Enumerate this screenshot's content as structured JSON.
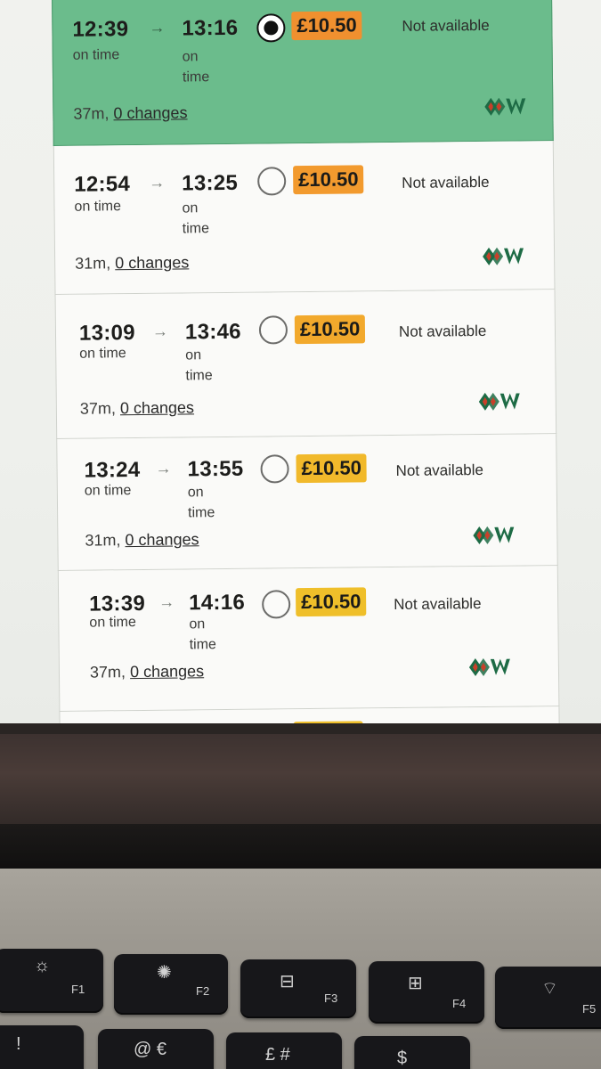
{
  "journeys": [
    {
      "dep": "12:39",
      "arr": "13:16",
      "dep_status": "on time",
      "arr_status": "on\ntime",
      "price": "£10.50",
      "availability": "Not available",
      "duration": "37m,",
      "changes": "0 changes",
      "selected": true,
      "price_color": "#f0902f"
    },
    {
      "dep": "12:54",
      "arr": "13:25",
      "dep_status": "on time",
      "arr_status": "on\ntime",
      "price": "£10.50",
      "availability": "Not available",
      "duration": "31m,",
      "changes": "0 changes",
      "selected": false,
      "price_color": "#f29a2e"
    },
    {
      "dep": "13:09",
      "arr": "13:46",
      "dep_status": "on time",
      "arr_status": "on\ntime",
      "price": "£10.50",
      "availability": "Not available",
      "duration": "37m,",
      "changes": "0 changes",
      "selected": false,
      "price_color": "#f2a92c"
    },
    {
      "dep": "13:24",
      "arr": "13:55",
      "dep_status": "on time",
      "arr_status": "on\ntime",
      "price": "£10.50",
      "availability": "Not available",
      "duration": "31m,",
      "changes": "0 changes",
      "selected": false,
      "price_color": "#f1b92b"
    },
    {
      "dep": "13:39",
      "arr": "14:16",
      "dep_status": "on time",
      "arr_status": "on\ntime",
      "price": "£10.50",
      "availability": "Not available",
      "duration": "37m,",
      "changes": "0 changes",
      "selected": false,
      "price_color": "#efbf2a"
    }
  ],
  "arrow": "→",
  "operator_logo": "gwr-logo",
  "keyboard": {
    "f1": "F1",
    "f2": "F2",
    "f3": "F3",
    "f4": "F4",
    "f5": "F5",
    "f1_icon": "brightness-down-icon",
    "f2_icon": "brightness-up-icon",
    "f3_icon": "mission-control-icon",
    "f4_icon": "launchpad-icon",
    "f5_icon": "keyboard-backlight-icon",
    "key_1": "!",
    "key_2": "@ €",
    "key_3": "£ #",
    "key_4": "$"
  },
  "colors": {
    "selected_bg": "#6bbc8c",
    "logo_green": "#1d6b45",
    "logo_red": "#c8402a"
  }
}
